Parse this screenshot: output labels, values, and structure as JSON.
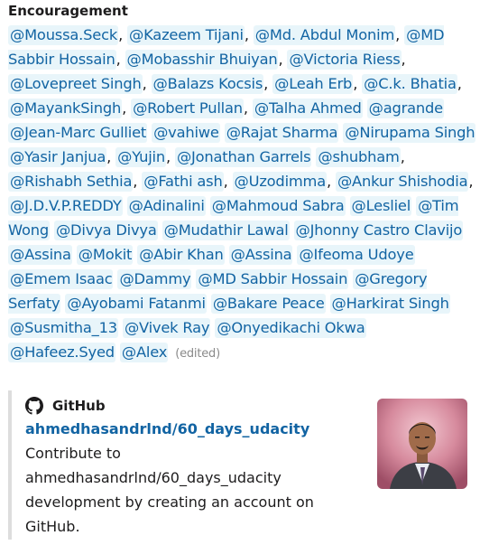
{
  "message": {
    "title": "Encouragement",
    "mentions": [
      "@Moussa.Seck",
      "@Kazeem Tijani",
      "@Md. Abdul Monim",
      "@MD Sabbir Hossain",
      "@Mobasshir Bhuiyan",
      "@Victoria Riess",
      "@Lovepreet Singh",
      "@Balazs Kocsis",
      "@Leah Erb",
      "@C.k. Bhatia",
      "@MayankSingh",
      "@Robert Pullan",
      "@Talha Ahmed",
      "@agrande",
      "@Jean-Marc Gulliet",
      "@vahiwe",
      "@Rajat Sharma",
      "@Nirupama Singh",
      "@Yasir Janjua",
      "@Yujin",
      "@Jonathan Garrels",
      "@shubham",
      "@Rishabh Sethia",
      "@Fathi ash",
      "@Uzodimma",
      "@Ankur Shishodia",
      "@J.D.V.P.REDDY",
      "@Adinalini",
      "@Mahmoud Sabra",
      "@Lesliel",
      "@Tim Wong",
      "@Divya Divya",
      "@Mudathir Lawal",
      "@Jhonny Castro Clavijo",
      "@Assina",
      "@Mokit",
      "@Abir Khan",
      "@Assina",
      "@Ifeoma Udoye",
      "@Emem Isaac",
      "@Dammy",
      "@MD Sabbir Hossain",
      "@Gregory Serfaty",
      "@Ayobami Fatanmi",
      "@Bakare Peace",
      "@Harkirat Singh",
      "@Susmitha_13",
      "@Vivek Ray",
      "@Onyedikachi Okwa",
      "@Hafeez.Syed",
      "@Alex"
    ],
    "separators": [
      ",",
      ",",
      ",",
      ",",
      ",",
      ",",
      ",",
      ",",
      ",",
      ",",
      ",",
      ",",
      "",
      "",
      "",
      "",
      "",
      "",
      ",",
      ",",
      "",
      ",",
      ",",
      ",",
      ",",
      ",",
      "",
      "",
      "",
      "",
      "",
      "",
      "",
      "",
      "",
      "",
      "",
      "",
      "",
      "",
      "",
      "",
      "",
      "",
      "",
      "",
      "",
      "",
      "",
      "",
      ""
    ],
    "edited_label": "(edited)"
  },
  "attachment": {
    "service_name": "GitHub",
    "service_icon": "github-icon",
    "link_title": "ahmedhasandrlnd/60_days_udacity",
    "description": "Contribute to ahmedhasandrlnd/60_days_udacity development by creating an account on GitHub.",
    "thumbnail": "avatar-photo"
  },
  "colors": {
    "mention_text": "#1264a3",
    "mention_bg": "#e8f5fa",
    "attachment_border": "#dddddd",
    "edited": "#8a8a8a"
  }
}
